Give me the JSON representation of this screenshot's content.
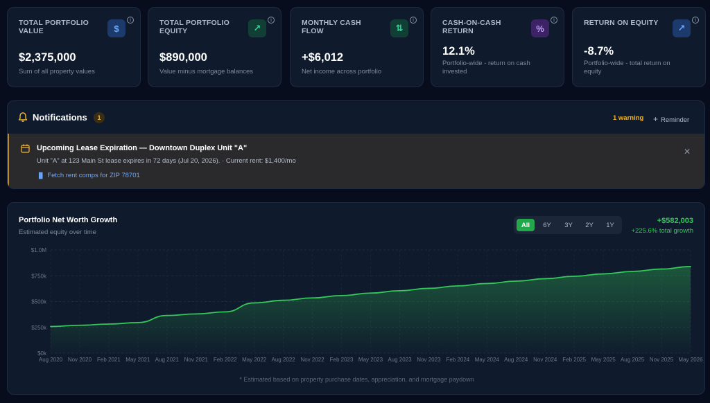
{
  "kpis": [
    {
      "label": "TOTAL PORTFOLIO VALUE",
      "value": "$2,375,000",
      "sub": "Sum of all property values",
      "icon": "dollar-icon",
      "icon_glyph": "$",
      "icon_bg": "#1c3a6b",
      "icon_color": "#6aa7ff"
    },
    {
      "label": "TOTAL PORTFOLIO EQUITY",
      "value": "$890,000",
      "sub": "Value minus mortgage balances",
      "icon": "trending-up-icon",
      "icon_glyph": "↗",
      "icon_bg": "#123f35",
      "icon_color": "#34d399"
    },
    {
      "label": "MONTHLY CASH FLOW",
      "value": "+$6,012",
      "sub": "Net income across portfolio",
      "icon": "arrows-up-down-icon",
      "icon_glyph": "⇅",
      "icon_bg": "#123f35",
      "icon_color": "#34d399"
    },
    {
      "label": "CASH-ON-CASH RETURN",
      "value": "12.1%",
      "sub": "Portfolio-wide - return on cash invested",
      "icon": "percent-icon",
      "icon_glyph": "%",
      "icon_bg": "#3b2366",
      "icon_color": "#c4a1ff"
    },
    {
      "label": "RETURN ON EQUITY",
      "value": "-8.7%",
      "sub": "Portfolio-wide - total return on equity",
      "icon": "trending-up-icon",
      "icon_glyph": "↗",
      "icon_bg": "#1c3a6b",
      "icon_color": "#6aa7ff"
    }
  ],
  "notifications": {
    "title": "Notifications",
    "count": "1",
    "warning_label": "1 warning",
    "reminder_label": "Reminder",
    "alert": {
      "title": "Upcoming Lease Expiration — Downtown Duplex Unit \"A\"",
      "body": "Unit \"A\" at 123 Main St lease expires in 72 days (Jul 20, 2026). · Current rent: $1,400/mo",
      "link": "Fetch rent comps for ZIP 78701"
    }
  },
  "chart_card": {
    "title": "Portfolio Net Worth Growth",
    "subtitle": "Estimated equity over time",
    "ranges": [
      "All",
      "6Y",
      "3Y",
      "2Y",
      "1Y"
    ],
    "active_range": "All",
    "gain_amount": "+$582,003",
    "gain_pct": "+225.6% total growth",
    "footnote": "* Estimated based on property purchase dates, appreciation, and mortgage paydown"
  },
  "chart_data": {
    "type": "area",
    "x": [
      "Aug 2020",
      "Nov 2020",
      "Feb 2021",
      "May 2021",
      "Aug 2021",
      "Nov 2021",
      "Feb 2022",
      "May 2022",
      "Aug 2022",
      "Nov 2022",
      "Feb 2023",
      "May 2023",
      "Aug 2023",
      "Nov 2023",
      "Feb 2024",
      "May 2024",
      "Aug 2024",
      "Nov 2024",
      "Feb 2025",
      "May 2025",
      "Aug 2025",
      "Nov 2025",
      "May 2026"
    ],
    "series": [
      {
        "values": [
          258000,
          270000,
          282000,
          296000,
          365000,
          380000,
          400000,
          487000,
          512000,
          535000,
          558000,
          582000,
          605000,
          628000,
          652000,
          675000,
          698000,
          722000,
          745000,
          768000,
          792000,
          815000,
          840000
        ]
      }
    ],
    "y_ticks": [
      "$0k",
      "$250k",
      "$500k",
      "$750k",
      "$1.0M"
    ],
    "ylim": [
      0,
      1000000
    ],
    "grid": true,
    "line_color": "#34c759"
  }
}
